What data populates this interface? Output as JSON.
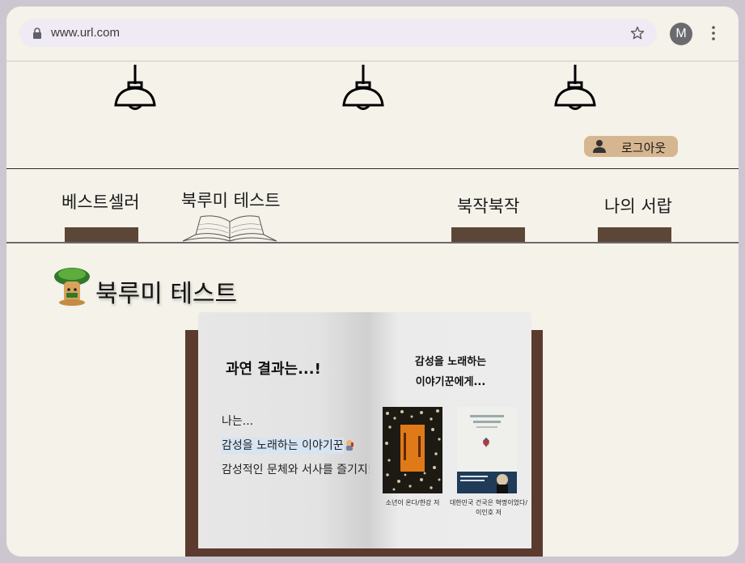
{
  "browser": {
    "url": "www.url.com",
    "profile_initial": "M"
  },
  "header": {
    "logout_label": "로그아웃"
  },
  "nav": {
    "items": [
      {
        "label": "베스트셀러"
      },
      {
        "label": "북루미 테스트"
      },
      {
        "label": "북작북작"
      },
      {
        "label": "나의 서랍"
      }
    ]
  },
  "main": {
    "heading": "북루미 테스트",
    "result": {
      "title": "과연 결과는...!",
      "intro": "나는...",
      "type_name": "감성을 노래하는 이야기꾼",
      "description": "감성적인 문체와 서사를 즐기지!",
      "right_title_line1": "감성을 노래하는",
      "right_title_line2": "이야기꾼에게...",
      "books": [
        {
          "caption": "소년이 온다/한강 저"
        },
        {
          "caption_line1": "대한민국 건국은 혁명이었다/",
          "caption_line2": "이인호 저"
        }
      ]
    }
  },
  "colors": {
    "background": "#f4f2e9",
    "shelf": "#5b4637",
    "logout_button": "#d6b690",
    "book_cover": "#5a3b2e",
    "highlight": "#d6e4f3"
  }
}
